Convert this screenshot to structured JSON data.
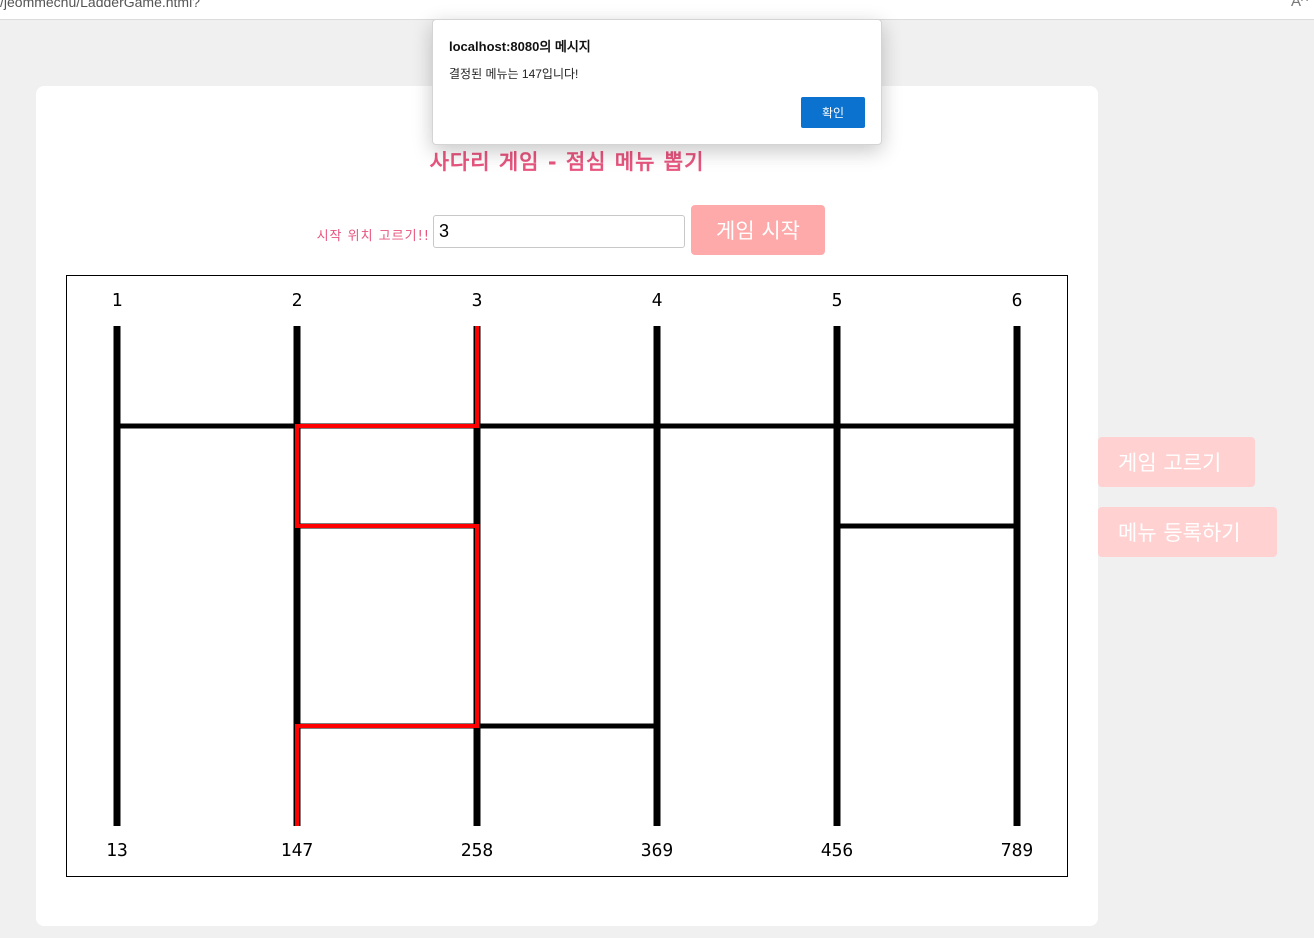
{
  "browser": {
    "url": "/jeommechu/LadderGame.html?",
    "reader_icon": "A^"
  },
  "game": {
    "title": "사다리 게임 - 점심 메뉴 뽑기",
    "start_label": "시작 위치 고르기!!",
    "start_value": "3",
    "start_button": "게임 시작"
  },
  "ladder": {
    "top_labels": [
      "1",
      "2",
      "3",
      "4",
      "5",
      "6"
    ],
    "bottom_labels": [
      "13",
      "147",
      "258",
      "369",
      "456",
      "789"
    ],
    "rungs": [
      {
        "from": 1,
        "to": 6,
        "level": 1
      },
      {
        "from": 2,
        "to": 3,
        "level": 2
      },
      {
        "from": 5,
        "to": 6,
        "level": 2
      },
      {
        "from": 2,
        "to": 4,
        "level": 4
      }
    ],
    "selected_start": 3,
    "result_column": 2,
    "ladder_color": "#000000",
    "path_color": "#ff0000"
  },
  "side": {
    "pick_game": "게임 고르기",
    "register_menu": "메뉴 등록하기"
  },
  "dialog": {
    "title": "localhost:8080의 메시지",
    "message": "결정된 메뉴는 147입니다!",
    "ok": "확인",
    "accent": "#0b72cf"
  }
}
